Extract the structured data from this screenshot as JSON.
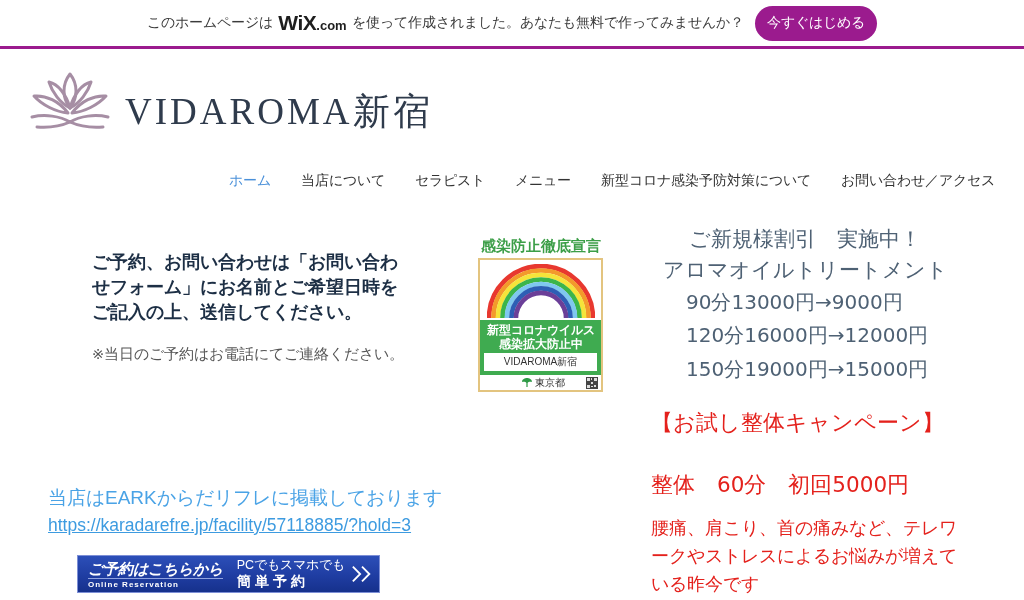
{
  "wix_banner": {
    "text_before": "このホームページは",
    "logo": {
      "mark": "WiX",
      "suffix": ".com"
    },
    "text_after": "を使って作成されました。あなたも無料で作ってみませんか？",
    "button": "今すぐはじめる"
  },
  "header": {
    "brand": "VIDAROMA新宿"
  },
  "nav": [
    {
      "label": "ホーム",
      "selected": true
    },
    {
      "label": "当店について",
      "selected": false
    },
    {
      "label": "セラピスト",
      "selected": false
    },
    {
      "label": "メニュー",
      "selected": false
    },
    {
      "label": "新型コロナ感染予防対策について",
      "selected": false
    },
    {
      "label": "お問い合わせ／アクセス",
      "selected": false
    }
  ],
  "booking_info": {
    "instruction": "ご予約、お問い合わせは「お問い合わせフォーム」にお名前とご希望日時をご記入の上、送信してください。",
    "note": "※当日のご予約はお電話にてご連絡ください。"
  },
  "sticker": {
    "title": "感染防止徹底宣言",
    "band_lines": [
      "新型コロナウイルス",
      "感染拡大防止中"
    ],
    "shop_name": "VIDAROMA新宿",
    "issuer": "東京都"
  },
  "listing": {
    "text": "当店はEARKからだリフレに掲載しております",
    "url": "https://karadarefre.jp/facility/57118885/?hold=3"
  },
  "reservation_banner": {
    "title": "ご予約はこちらから",
    "subtitle": "Online Reservation",
    "tagline": "PCでもスマホでも",
    "action": "簡単予約"
  },
  "promotion": {
    "heading": "ご新規様割引　実施中！",
    "service": "アロマオイルトリートメント",
    "prices": [
      "90分13000円→9000円",
      "120分16000円→12000円",
      "150分19000円→15000円"
    ]
  },
  "campaign": {
    "heading": "【お試し整体キャンペーン】",
    "offer": "整体　60分　初回5000円",
    "description": "腰痛、肩こり、首の痛みなど、テレワークやストレスによるお悩みが増えている昨今です"
  }
}
